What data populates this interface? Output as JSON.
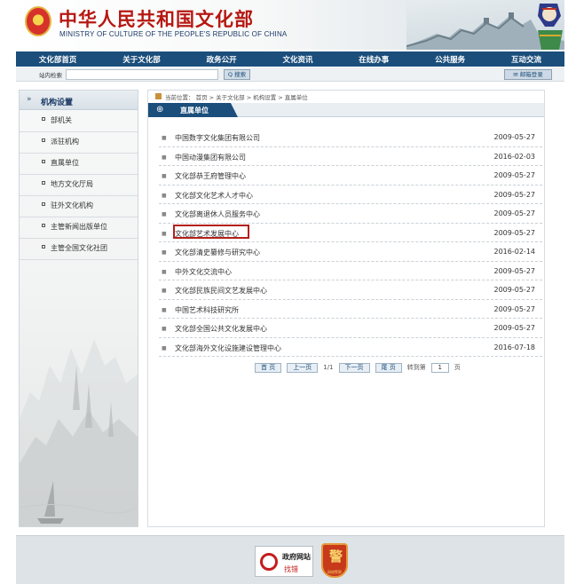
{
  "header": {
    "title_cn": "中华人民共和国文化部",
    "title_en": "MINISTRY OF CULTURE OF THE PEOPLE'S REPUBLIC OF CHINA"
  },
  "nav": [
    "文化部首页",
    "关于文化部",
    "政务公开",
    "文化资讯",
    "在线办事",
    "公共服务",
    "互动交流"
  ],
  "search": {
    "label": "站内检索",
    "value": "",
    "button": "Q 搜索",
    "mail_button": "✉ 邮箱登录"
  },
  "sidebar": {
    "title": "机构设置",
    "items": [
      "部机关",
      "派驻机构",
      "直属单位",
      "地方文化厅局",
      "驻外文化机构",
      "主管新闻出版单位",
      "主管全国文化社团"
    ]
  },
  "breadcrumb": "当前位置： 首页 > 关于文化部 > 机构设置 > 直属单位",
  "section_tab": "直属单位",
  "units": [
    {
      "name": "中国数字文化集团有限公司",
      "date": "2009-05-27"
    },
    {
      "name": "中国动漫集团有限公司",
      "date": "2016-02-03"
    },
    {
      "name": "文化部恭王府管理中心",
      "date": "2009-05-27"
    },
    {
      "name": "文化部文化艺术人才中心",
      "date": "2009-05-27"
    },
    {
      "name": "文化部离退休人员服务中心",
      "date": "2009-05-27"
    },
    {
      "name": "文化部艺术发展中心",
      "date": "2009-05-27"
    },
    {
      "name": "文化部清史纂修与研究中心",
      "date": "2016-02-14"
    },
    {
      "name": "中外文化交流中心",
      "date": "2009-05-27"
    },
    {
      "name": "文化部民族民间文艺发展中心",
      "date": "2009-05-27"
    },
    {
      "name": "中国艺术科技研究所",
      "date": "2009-05-27"
    },
    {
      "name": "文化部全国公共文化发展中心",
      "date": "2009-05-27"
    },
    {
      "name": "文化部海外文化设施建设管理中心",
      "date": "2016-07-18"
    }
  ],
  "highlighted_unit": "文化部艺术发展中心",
  "pagination": {
    "first": "首 页",
    "prev": "上一页",
    "page_status": "1/1",
    "next": "下一页",
    "last": "尾 页",
    "goto_label": "转到第",
    "page_value": "1",
    "page_suffix": "页"
  },
  "footer": {
    "gov_site_title": "政府网站",
    "gov_site_action": "找错",
    "police_badge_glyph": "警",
    "police_badge_label": "网络警察"
  },
  "colors": {
    "nav_blue": "#1b4e7b",
    "title_red": "#b61812",
    "highlight_red": "#b3201b"
  }
}
